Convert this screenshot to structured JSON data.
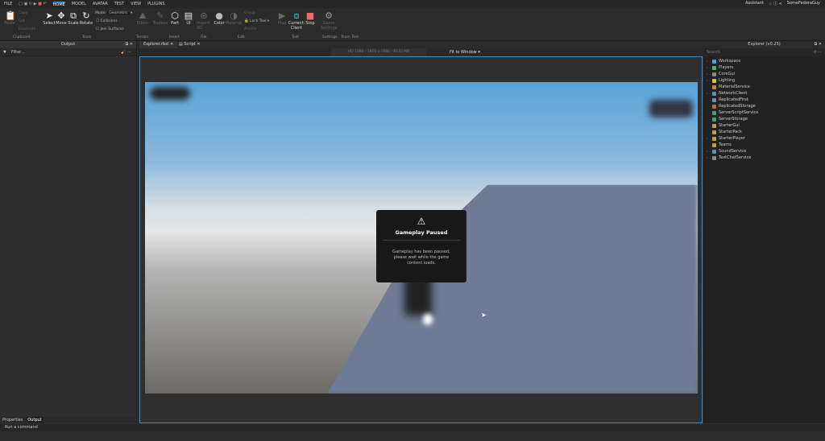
{
  "menu": {
    "file": "FILE",
    "tabs": [
      "HOME",
      "MODEL",
      "AVATAR",
      "TEST",
      "VIEW",
      "PLUGINS"
    ],
    "assistant": "Assistant",
    "user": "SomeFedoraGuy"
  },
  "ribbon": {
    "clipboard": {
      "paste": "Paste",
      "copy": "Copy",
      "cut": "Cut",
      "duplicate": "Duplicate",
      "group": "Clipboard"
    },
    "tools": {
      "select": "Select",
      "move": "Move",
      "scale": "Scale",
      "rotate": "Rotate",
      "mode_label": "Mode:",
      "mode": "Geometric",
      "collisions": "Collisions",
      "join": "Join Surfaces",
      "group": "Tools"
    },
    "terrain": {
      "editor": "Editor",
      "group": "Terrain"
    },
    "insert": {
      "toolbox": "Toolbox",
      "part": "Part",
      "ui": "UI",
      "group": "Insert"
    },
    "file": {
      "import": "Import 3D",
      "group": "File"
    },
    "edit": {
      "color": "Color",
      "material": "Material",
      "group_btn": "Group",
      "lock": "Lock Tool",
      "anchor": "Anchor",
      "group": "Edit"
    },
    "test": {
      "play": "Play",
      "current": "Current: Client",
      "stop": "Stop",
      "group": "Test"
    },
    "settings": {
      "game": "Game Settings",
      "group": "Settings"
    },
    "teamtest": {
      "group": "Team Test"
    }
  },
  "output": {
    "title": "Output",
    "filter": "Filter..."
  },
  "doc_tabs": [
    "Explorer.rbxl",
    "Script"
  ],
  "viewport": {
    "resolution": "HD 1080 · 1920 x 1080 · 6132 MB",
    "fit": "Fit to Window"
  },
  "dialog": {
    "title": "Gameplay Paused",
    "body": "Gameplay has been paused; please wait while the game content loads."
  },
  "explorer": {
    "title": "Explorer (v0.25)",
    "search": "Search",
    "items": [
      {
        "name": "Workspace",
        "arrow": true,
        "color": "#4aa3df"
      },
      {
        "name": "Players",
        "arrow": true,
        "color": "#5fb35f"
      },
      {
        "name": "CoreGui",
        "arrow": true,
        "color": "#888888"
      },
      {
        "name": "Lighting",
        "arrow": true,
        "color": "#e5c040"
      },
      {
        "name": "MaterialService",
        "arrow": false,
        "color": "#c08a40"
      },
      {
        "name": "NetworkClient",
        "arrow": true,
        "color": "#5a8fb0"
      },
      {
        "name": "ReplicatedFirst",
        "arrow": false,
        "color": "#6a8fb0"
      },
      {
        "name": "ReplicatedStorage",
        "arrow": false,
        "color": "#b07040"
      },
      {
        "name": "ServerScriptService",
        "arrow": false,
        "color": "#40a070"
      },
      {
        "name": "ServerStorage",
        "arrow": false,
        "color": "#40a070"
      },
      {
        "name": "StarterGui",
        "arrow": false,
        "color": "#c0a050"
      },
      {
        "name": "StarterPack",
        "arrow": false,
        "color": "#c0a050"
      },
      {
        "name": "StarterPlayer",
        "arrow": true,
        "color": "#c0a050"
      },
      {
        "name": "Teams",
        "arrow": false,
        "color": "#c0a050"
      },
      {
        "name": "SoundService",
        "arrow": true,
        "color": "#5a8fb0"
      },
      {
        "name": "TextChatService",
        "arrow": true,
        "color": "#888888"
      }
    ]
  },
  "bottom": {
    "tabs": [
      "Properties",
      "Output"
    ],
    "command": "Run a command"
  }
}
